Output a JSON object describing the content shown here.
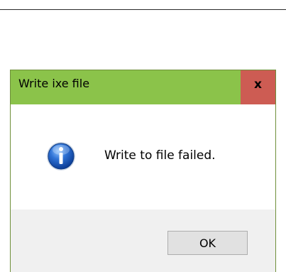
{
  "dialog": {
    "title": "Write ixe file",
    "close_symbol": "x",
    "message": "Write to file failed.",
    "icon": "info-icon",
    "ok_label": "OK"
  },
  "colors": {
    "titlebar": "#8bc34a",
    "close_button": "#cd5c53",
    "footer": "#f0f0f0",
    "icon_blue": "#1e5fbf"
  }
}
